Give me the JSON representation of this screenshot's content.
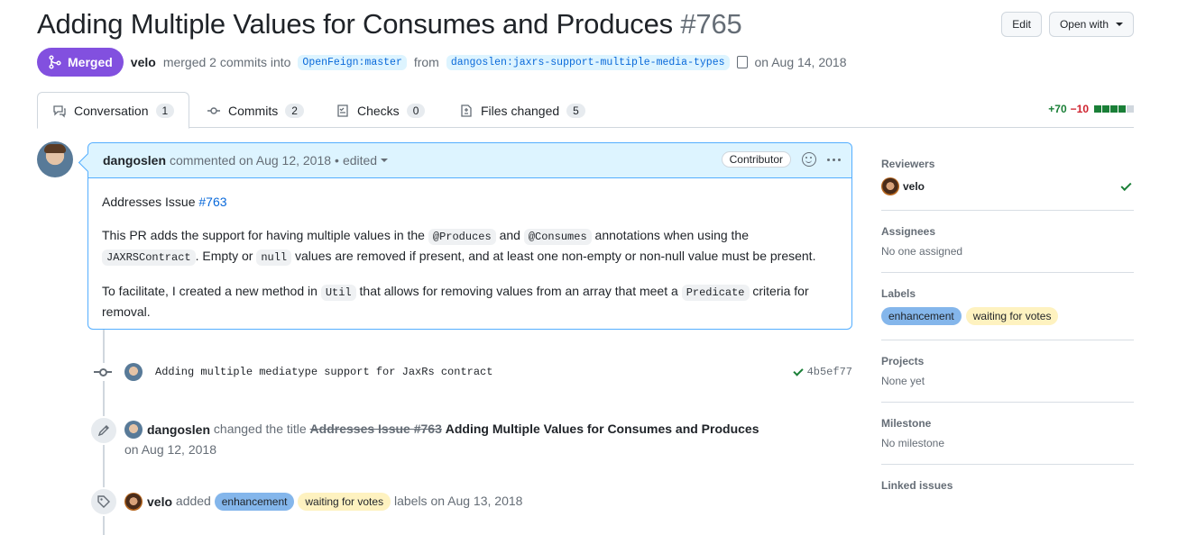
{
  "pr": {
    "title": "Adding Multiple Values for Consumes and Produces",
    "number": "#765",
    "state": "Merged",
    "author": "velo",
    "merge_text": "merged 2 commits into",
    "base_branch": "OpenFeign:master",
    "from_text": "from",
    "head_branch": "dangoslen:jaxrs-support-multiple-media-types",
    "date_text": "on Aug 14, 2018"
  },
  "header_buttons": {
    "edit": "Edit",
    "open_with": "Open with"
  },
  "tabs": [
    {
      "label": "Conversation",
      "count": "1"
    },
    {
      "label": "Commits",
      "count": "2"
    },
    {
      "label": "Checks",
      "count": "0"
    },
    {
      "label": "Files changed",
      "count": "5"
    }
  ],
  "diffstat": {
    "additions": "+70",
    "deletions": "−10"
  },
  "colors": {
    "merged": "#8250df",
    "link": "#0969da",
    "addition": "#1a7f37",
    "deletion": "#cf222e",
    "comment_border": "#54aeff"
  },
  "comment": {
    "author": "dangoslen",
    "meta": "commented on Aug 12, 2018",
    "separator": "•",
    "edited": "edited",
    "role": "Contributor",
    "p1_prefix": "Addresses Issue",
    "p1_link": "#763",
    "p2_a": "This PR adds the support for having multiple values in the",
    "p2_code1": "@Produces",
    "p2_and": "and",
    "p2_code2": "@Consumes",
    "p2_b": "annotations when using the",
    "p2_code3": "JAXRSContract",
    "p2_c": ". Empty or",
    "p2_code4": "null",
    "p2_d": "values are removed if present, and at least one non-empty or non-null value must be present.",
    "p3_a": "To facilitate, I created a new method in",
    "p3_code1": "Util",
    "p3_b": "that allows for removing values from an array that meet a",
    "p3_code2": "Predicate",
    "p3_c": "criteria for removal."
  },
  "commit": {
    "message": "Adding multiple mediatype support for JaxRs contract",
    "sha": "4b5ef77"
  },
  "rename_event": {
    "actor": "dangoslen",
    "action": "changed the title",
    "old_title": "Addresses Issue #763",
    "new_title": "Adding Multiple Values for Consumes and Produces",
    "date": "on Aug 12, 2018"
  },
  "label_event": {
    "actor": "velo",
    "action": "added",
    "suffix": "labels on Aug 13, 2018"
  },
  "labels": {
    "enhancement": "enhancement",
    "waiting": "waiting for votes"
  },
  "sidebar": {
    "reviewers_title": "Reviewers",
    "reviewer": "velo",
    "assignees_title": "Assignees",
    "assignees_value": "No one assigned",
    "labels_title": "Labels",
    "projects_title": "Projects",
    "projects_value": "None yet",
    "milestone_title": "Milestone",
    "milestone_value": "No milestone",
    "linked_title": "Linked issues"
  }
}
